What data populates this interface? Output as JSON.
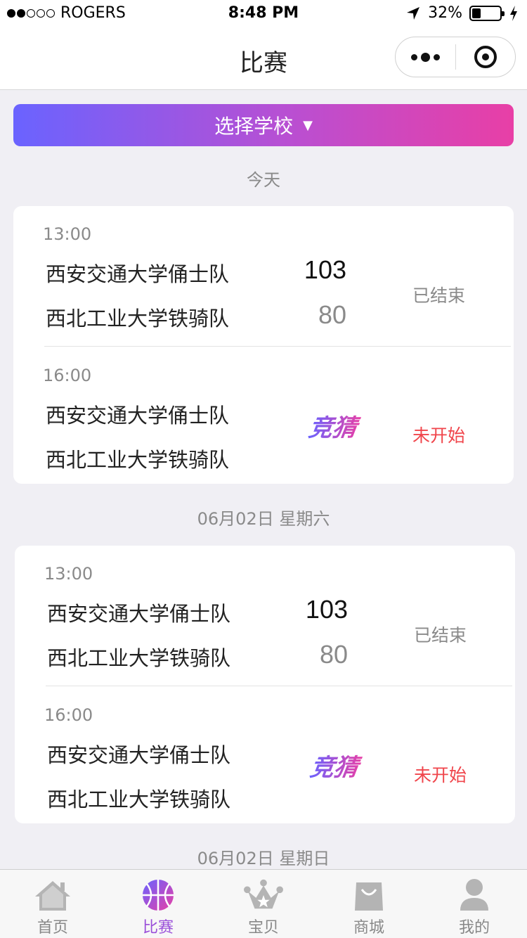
{
  "status_bar": {
    "carrier": "ROGERS",
    "time": "8:48 PM",
    "battery": "32%",
    "battery_level": 0.32
  },
  "nav": {
    "title": "比赛"
  },
  "select_school": {
    "label": "选择学校",
    "caret": "▼"
  },
  "sections": [
    {
      "date": "今天",
      "matches": [
        {
          "time": "13:00",
          "team_a": "西安交通大学俑士队",
          "team_b": "西北工业大学铁骑队",
          "score_a": "103",
          "score_b": "80",
          "status": "已结束"
        },
        {
          "time": "16:00",
          "team_a": "西安交通大学俑士队",
          "team_b": "西北工业大学铁骑队",
          "guess": "竞猜",
          "status": "未开始"
        }
      ]
    },
    {
      "date": "06月02日  星期六",
      "matches": [
        {
          "time": "13:00",
          "team_a": "西安交通大学俑士队",
          "team_b": "西北工业大学铁骑队",
          "score_a": "103",
          "score_b": "80",
          "status": "已结束"
        },
        {
          "time": "16:00",
          "team_a": "西安交通大学俑士队",
          "team_b": "西北工业大学铁骑队",
          "guess": "竞猜",
          "status": "未开始"
        }
      ]
    },
    {
      "date": "06月02日  星期日"
    }
  ],
  "tabs": [
    {
      "label": "首页",
      "icon": "home-icon"
    },
    {
      "label": "比赛",
      "icon": "basketball-icon",
      "active": true
    },
    {
      "label": "宝贝",
      "icon": "crown-icon"
    },
    {
      "label": "商城",
      "icon": "shopping-bag-icon"
    },
    {
      "label": "我的",
      "icon": "user-icon"
    }
  ],
  "colors": {
    "accent_start": "#6a63ff",
    "accent_end": "#e83fa6",
    "pending": "#f0454b",
    "active_tab": "#9a4fd9"
  }
}
